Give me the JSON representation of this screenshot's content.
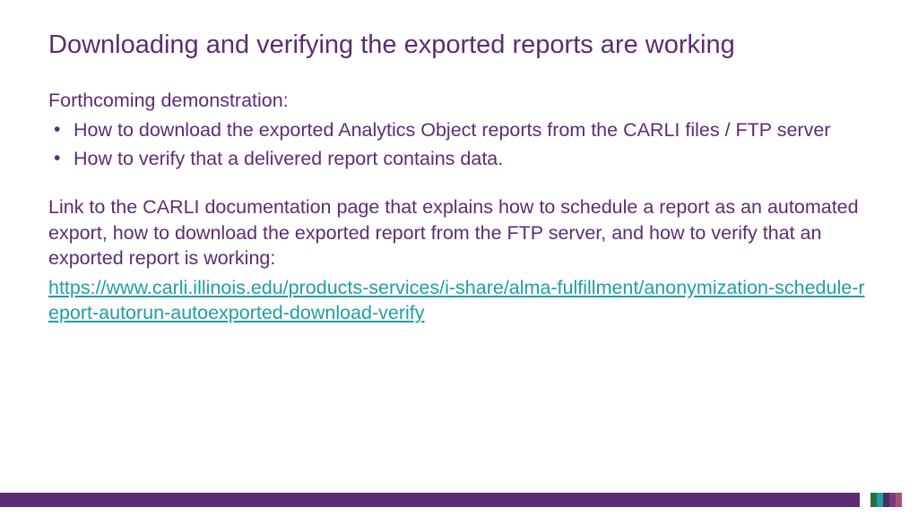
{
  "title": "Downloading and verifying the exported reports are working",
  "intro": "Forthcoming demonstration:",
  "bullets": [
    "How to download the exported Analytics Object reports from the CARLI files / FTP server",
    "How to verify that a delivered report contains data."
  ],
  "paragraph": "Link to the CARLI documentation page that explains how to schedule a report as an automated export, how to download the exported report from the FTP server, and how to verify that an exported report is working:",
  "link_text": "https://www.carli.illinois.edu/products-services/i-share/alma-fulfillment/anonymization-schedule-report-autorun-autoexported-download-verify"
}
